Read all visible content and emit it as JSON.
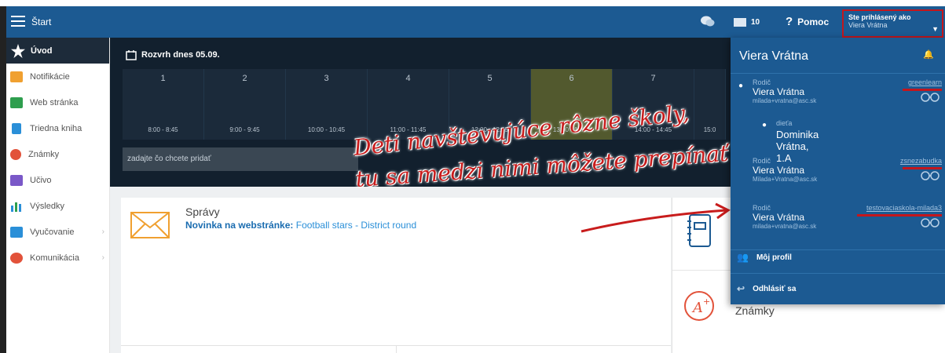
{
  "topbar": {
    "start_label": "Štart",
    "mail_count": "10",
    "help_label": "Pomoc",
    "login_label": "Ste prihlásený ako",
    "login_user": "Viera Vrátna"
  },
  "sidebar": {
    "items": [
      {
        "label": "Úvod",
        "icon": "star-icon",
        "color": "#ffffff"
      },
      {
        "label": "Notifikácie",
        "icon": "envelope-icon",
        "color": "#f0a030"
      },
      {
        "label": "Web stránka",
        "icon": "home-icon",
        "color": "#2e9e4e"
      },
      {
        "label": "Triedna kniha",
        "icon": "book-icon",
        "color": "#2a8fd8"
      },
      {
        "label": "Známky",
        "icon": "grade-icon",
        "color": "#e2523a"
      },
      {
        "label": "Učivo",
        "icon": "learning-icon",
        "color": "#7a58c8"
      },
      {
        "label": "Výsledky",
        "icon": "chart-icon",
        "color": "#2a8fd8"
      },
      {
        "label": "Vyučovanie",
        "icon": "teaching-icon",
        "color": "#2a8fd8"
      },
      {
        "label": "Komunikácia",
        "icon": "chat-icon",
        "color": "#e2523a"
      }
    ]
  },
  "timetable": {
    "title": "Rozvrh dnes 05.09.",
    "periods": [
      {
        "n": "1",
        "time": "8:00 - 8:45"
      },
      {
        "n": "2",
        "time": "9:00 - 9:45"
      },
      {
        "n": "3",
        "time": "10:00 - 10:45"
      },
      {
        "n": "4",
        "time": "11:00 - 11:45"
      },
      {
        "n": "5",
        "time": "12:00 - 12:45"
      },
      {
        "n": "6",
        "time": "13:00 - 13:45"
      },
      {
        "n": "7",
        "time": "14:00 - 14:45"
      },
      {
        "n": "",
        "time": "15:0"
      }
    ],
    "highlight_index": 5,
    "input_placeholder": "zadajte čo chcete pridať"
  },
  "messages": {
    "title": "Správy",
    "line_prefix": "Novinka na webstránke:",
    "line_text": "Football stars - District round"
  },
  "right_cards": {
    "grades_label": "Známky"
  },
  "dropdown": {
    "user_name": "Viera Vrátna",
    "accounts": [
      {
        "role": "Rodič",
        "name": "Viera Vrátna",
        "email": "milada+vratna@asc.sk",
        "school": "greenlearn",
        "active": true
      },
      {
        "role": "Rodič",
        "name": "Viera Vrátna",
        "email": "Milada+Vratna@asc.sk",
        "school": "zsnezabudka",
        "active": false
      },
      {
        "role": "Rodič",
        "name": "Viera Vrátna",
        "email": "milada+vratna@asc.sk",
        "school": "testovaciaskola-milada3",
        "active": false
      }
    ],
    "child_role": "dieťa",
    "child_name": "Dominika Vrátna, 1.A",
    "my_profile": "Môj profil",
    "logout": "Odhlásiť sa"
  },
  "annotation": {
    "line1": "Deti navštevujúce rôzne školy,",
    "line2": "tu sa medzi nimi môžete prepínať"
  },
  "colors": {
    "topbar": "#1c5a92",
    "timetable_bg": "#12202e",
    "highlight": "#52592e",
    "annotation": "#c81c1c"
  }
}
